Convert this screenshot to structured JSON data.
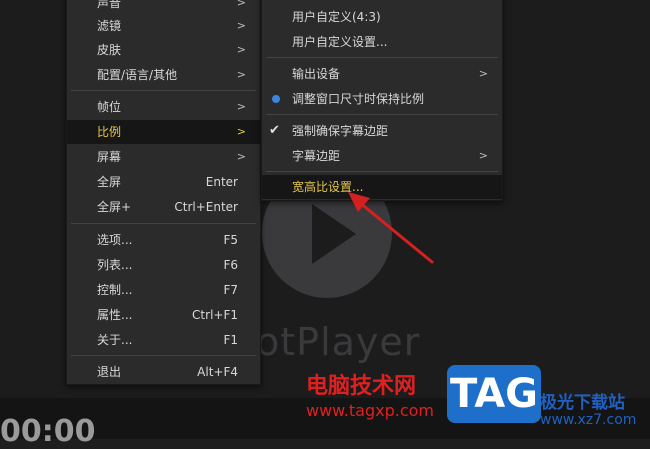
{
  "player": {
    "logo_text": "otPlayer",
    "time": "00:00"
  },
  "main_menu": {
    "items": [
      {
        "label": "声音",
        "arrow": ">"
      },
      {
        "label": "滤镜",
        "arrow": ">"
      },
      {
        "label": "皮肤",
        "arrow": ">"
      },
      {
        "label": "配置/语言/其他",
        "arrow": ">"
      },
      {
        "label": "帧位",
        "arrow": ">"
      },
      {
        "label": "比例",
        "arrow": ">"
      },
      {
        "label": "屏幕",
        "arrow": ">"
      },
      {
        "label": "全屏",
        "shortcut": "Enter"
      },
      {
        "label": "全屏+",
        "shortcut": "Ctrl+Enter"
      },
      {
        "label": "选项...",
        "shortcut": "F5"
      },
      {
        "label": "列表...",
        "shortcut": "F6"
      },
      {
        "label": "控制...",
        "shortcut": "F7"
      },
      {
        "label": "属性...",
        "shortcut": "Ctrl+F1"
      },
      {
        "label": "关于...",
        "shortcut": "F1"
      },
      {
        "label": "退出",
        "shortcut": "Alt+F4"
      }
    ]
  },
  "sub_menu": {
    "items": [
      {
        "label": "用户自定义(4:3)"
      },
      {
        "label": "用户自定义设置..."
      },
      {
        "label": "输出设备",
        "arrow": ">"
      },
      {
        "label": "调整窗口尺寸时保持比例"
      },
      {
        "label": "强制确保字幕边距"
      },
      {
        "label": "字幕边距",
        "arrow": ">"
      },
      {
        "label": "宽高比设置..."
      }
    ]
  },
  "watermark": {
    "site_name": "电脑技术网",
    "url": "www.tagxp.com",
    "tag": "TAG",
    "site2": "极光下载站",
    "site2_url": "www.xz7.com"
  },
  "colors": {
    "highlight_text": "#e6c84a",
    "radio": "#3c86e0",
    "annotation_arrow": "#d42020"
  }
}
